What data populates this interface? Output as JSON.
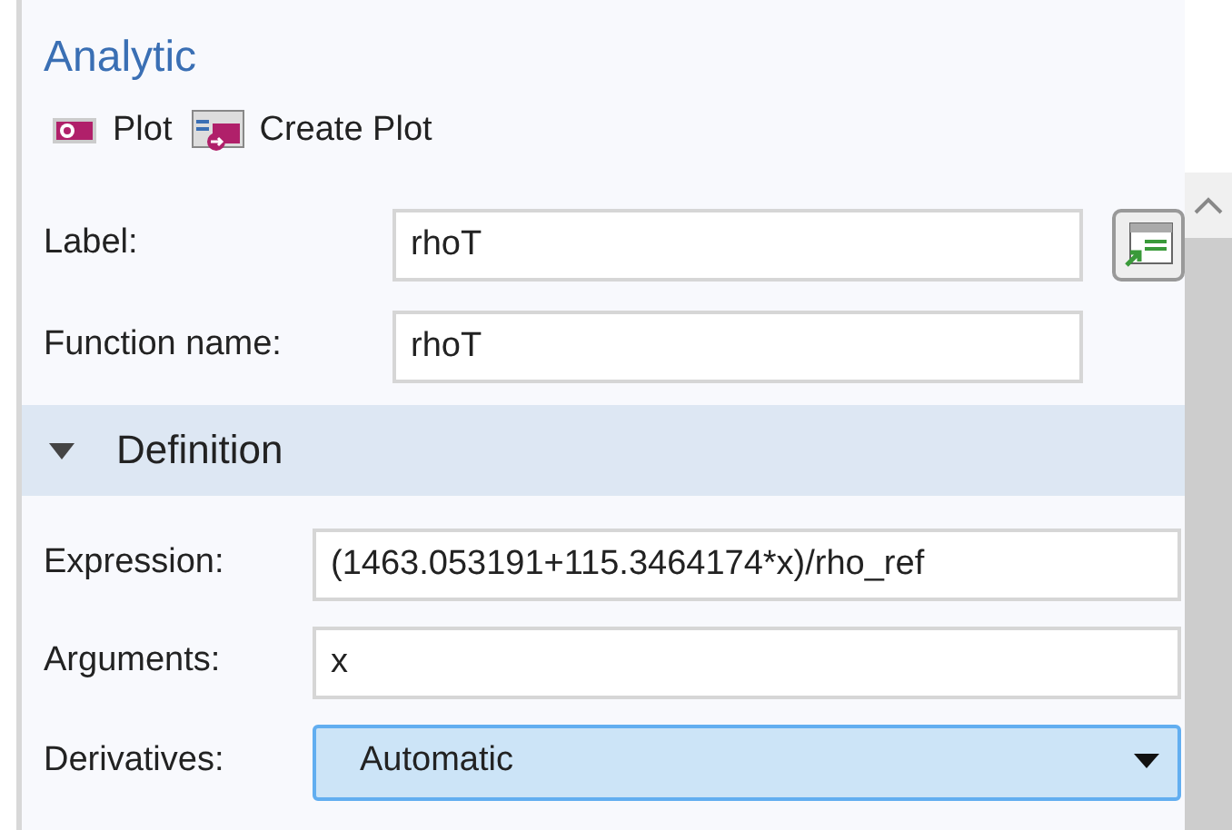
{
  "title": "Analytic",
  "toolbar": [
    {
      "label": "Plot",
      "kind": "plot"
    },
    {
      "label": "Create Plot",
      "kind": "create"
    }
  ],
  "fields": [
    {
      "label": "Label:",
      "value": "rhoT"
    },
    {
      "label": "Function name:",
      "value": "rhoT"
    }
  ],
  "section": {
    "title": "Definition",
    "expanded": true,
    "fields": [
      {
        "label": "Expression:",
        "value": "(1463.053191+115.3464174*x)/rho_ref",
        "kind": "text"
      },
      {
        "label": "Arguments:",
        "value": "x",
        "kind": "text"
      },
      {
        "label": "Derivatives:",
        "value": "Automatic",
        "kind": "select"
      }
    ]
  }
}
